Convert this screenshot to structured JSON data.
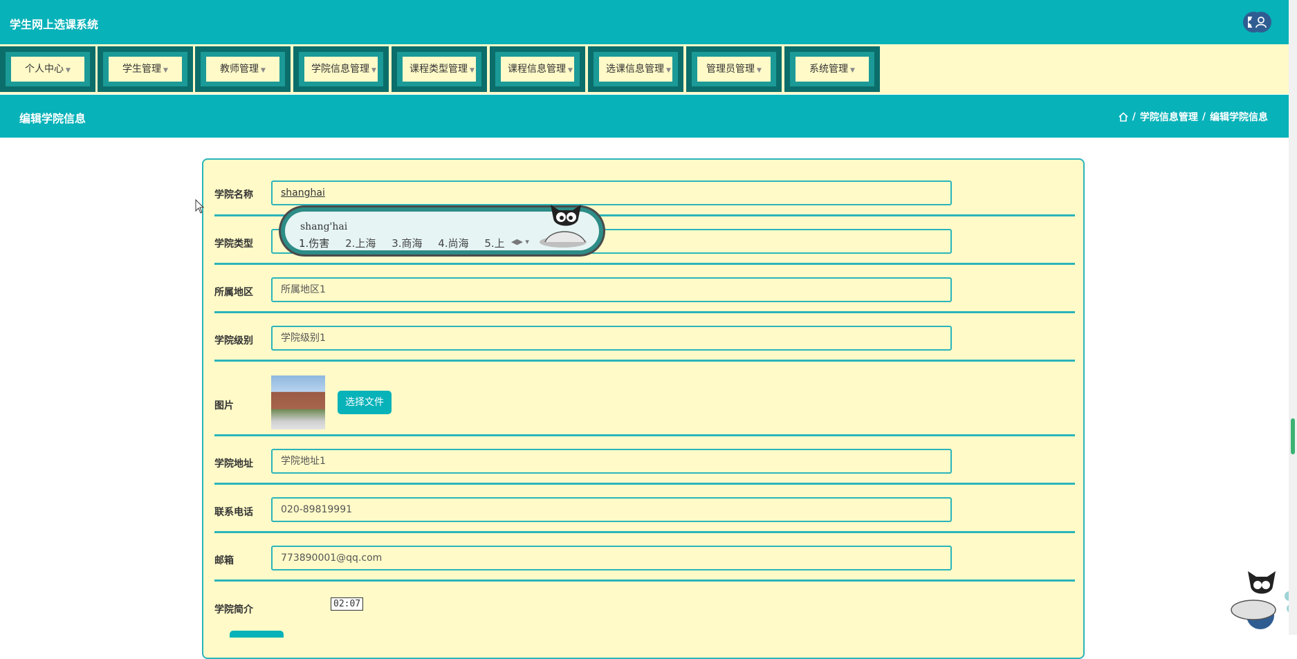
{
  "app": {
    "title": "学生网上选课系统"
  },
  "header_icons": [
    "fullscreen-icon",
    "user-icon"
  ],
  "nav": {
    "items": [
      {
        "label": "个人中心"
      },
      {
        "label": "学生管理"
      },
      {
        "label": "教师管理"
      },
      {
        "label": "学院信息管理"
      },
      {
        "label": "课程类型管理"
      },
      {
        "label": "课程信息管理"
      },
      {
        "label": "选课信息管理"
      },
      {
        "label": "管理员管理"
      },
      {
        "label": "系统管理"
      }
    ]
  },
  "section": {
    "title": "编辑学院信息",
    "breadcrumb": {
      "sep1": "/",
      "level1": "学院信息管理",
      "sep2": "/",
      "level2": "编辑学院信息"
    }
  },
  "form": {
    "college_name": {
      "label": "学院名称",
      "value": "shanghai"
    },
    "college_type": {
      "label": "学院类型",
      "value": ""
    },
    "region": {
      "label": "所属地区",
      "value": "所属地区1"
    },
    "level": {
      "label": "学院级别",
      "value": "学院级别1"
    },
    "image": {
      "label": "图片",
      "button": "选择文件"
    },
    "address": {
      "label": "学院地址",
      "value": "学院地址1"
    },
    "phone": {
      "label": "联系电话",
      "value": "020-89819991"
    },
    "email": {
      "label": "邮箱",
      "value": "773890001@qq.com"
    },
    "intro": {
      "label": "学院简介"
    }
  },
  "ime": {
    "pinyin": "shang'hai",
    "candidates": [
      "1.伤害",
      "2.上海",
      "3.商海",
      "4.尚海",
      "5.上"
    ]
  },
  "tooltip": {
    "time": "02:07"
  },
  "colors": {
    "primary": "#07b2b9",
    "nav_bg": "#fffac8",
    "nav_tile": "#0b6e6b",
    "icon_bg": "#2f5d92"
  }
}
